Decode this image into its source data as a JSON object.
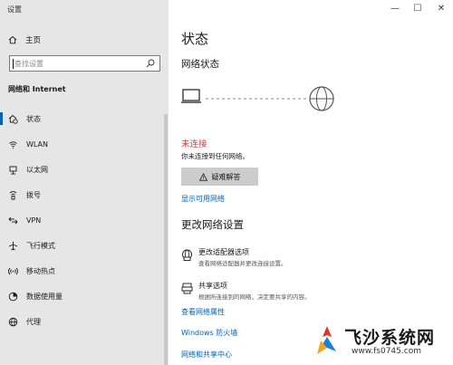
{
  "window": {
    "title": "设置",
    "controls": {
      "minimize": "—",
      "maximize": "☐",
      "close": "✕"
    }
  },
  "sidebar": {
    "home_label": "主页",
    "search": {
      "placeholder": "查找设置"
    },
    "section_title": "网络和 Internet",
    "items": [
      {
        "label": "状态",
        "icon": "home-globe-icon",
        "active": true
      },
      {
        "label": "WLAN",
        "icon": "wifi-icon"
      },
      {
        "label": "以太网",
        "icon": "ethernet-icon"
      },
      {
        "label": "拨号",
        "icon": "dialup-icon"
      },
      {
        "label": "VPN",
        "icon": "vpn-icon"
      },
      {
        "label": "飞行模式",
        "icon": "airplane-icon"
      },
      {
        "label": "移动热点",
        "icon": "hotspot-icon"
      },
      {
        "label": "数据使用量",
        "icon": "data-usage-icon"
      },
      {
        "label": "代理",
        "icon": "globe-icon"
      }
    ]
  },
  "main": {
    "page_title": "状态",
    "network_status_title": "网络状态",
    "status": {
      "text": "未连接",
      "description": "你未连接到任何网络。",
      "color": "#d13438"
    },
    "troubleshoot_label": "疑难解答",
    "show_networks_link": "显示可用网络",
    "change_settings_title": "更改网络设置",
    "options": [
      {
        "title": "更改适配器选项",
        "description": "查看网络适配器并更改连接设置。",
        "icon": "adapter-icon"
      },
      {
        "title": "共享选项",
        "description": "根据所连接到的网络，决定要共享的内容。",
        "icon": "sharing-icon"
      }
    ],
    "links": [
      "查看网络属性",
      "Windows 防火墙",
      "网络和共享中心"
    ]
  },
  "watermark": {
    "text": "飞沙系统网",
    "url": "www.fs0745.com"
  },
  "colors": {
    "accent": "#0063b1",
    "sidebar_bg": "#e6e6e6",
    "error": "#d13438"
  }
}
